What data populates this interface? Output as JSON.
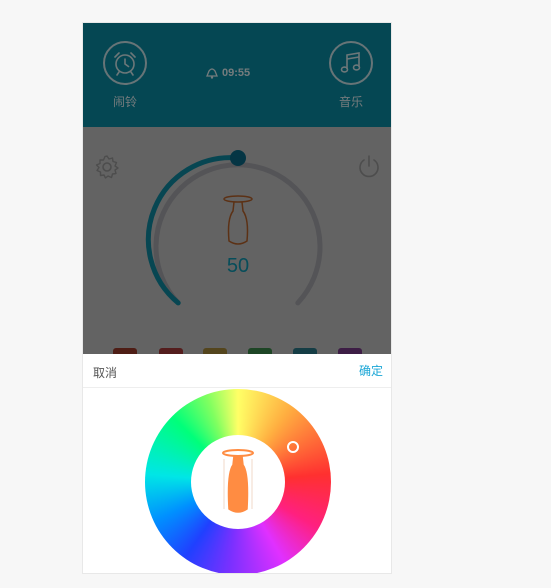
{
  "header": {
    "alarm_label": "闹铃",
    "music_label": "音乐",
    "time": "09:55",
    "alarm_icon": "alarm-clock-icon",
    "music_icon": "music-note-icon",
    "time_icon": "bell-icon"
  },
  "main": {
    "settings_icon": "gear-icon",
    "power_icon": "power-icon",
    "brightness_value": "50",
    "brightness_level_percent": 50,
    "swatches": [
      "#c0392b",
      "#c0392b",
      "#c9a227",
      "#27ae60",
      "#0e9bb4",
      "#8e44ad"
    ]
  },
  "sheet": {
    "cancel_label": "取消",
    "confirm_label": "确定",
    "lamp_color": "#ff8c42"
  },
  "colors": {
    "header_bg": "#0b8fa6",
    "accent": "#1aa6d6",
    "dial_active": "#0e9bb4"
  }
}
